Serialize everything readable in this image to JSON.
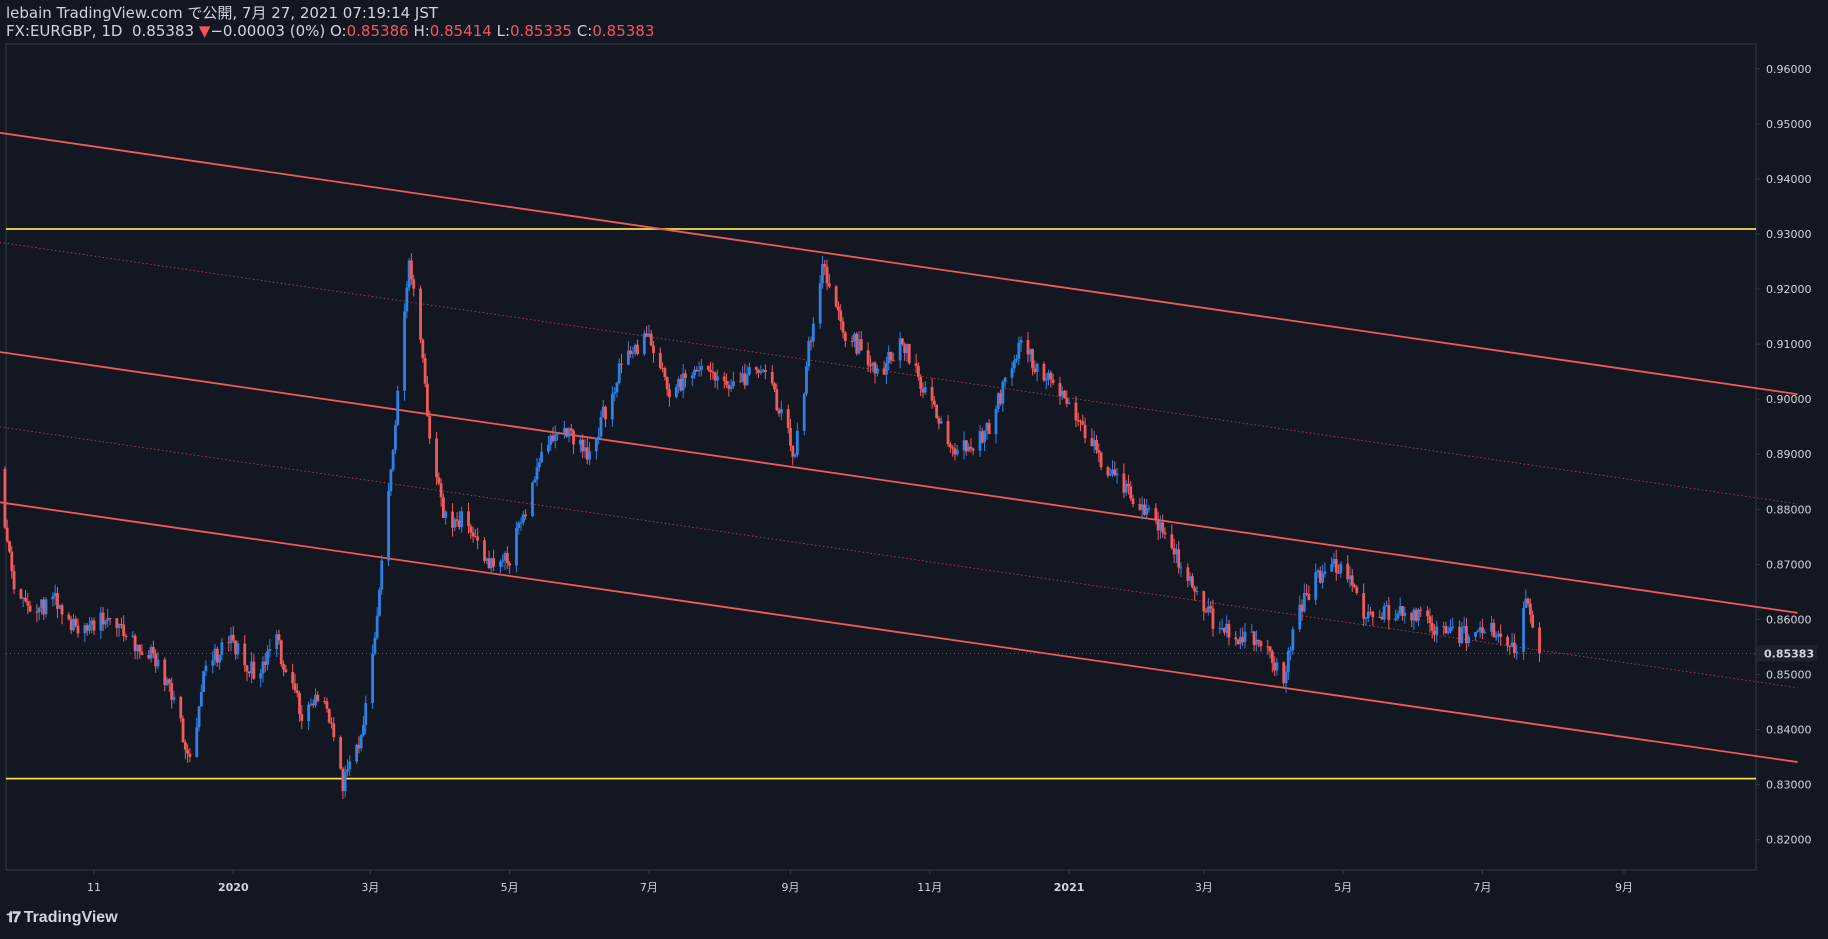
{
  "header": {
    "publisher": "lebain TradingView.com で公開, 7月 27, 2021 07:19:14 JST",
    "symbol": "FX:EURGBP, 1D",
    "last": "0.85383",
    "change_arrow": "▼",
    "change": "−0.00003 (0%)",
    "o_label": "O:",
    "o_value": "0.85386",
    "h_label": "H:",
    "h_value": "0.85414",
    "l_label": "L:",
    "l_value": "0.85335",
    "c_label": "C:",
    "c_value": "0.85383"
  },
  "footer": {
    "logo_text": "TradingView",
    "logo_icon": "tradingview-logo-icon"
  },
  "colors": {
    "background": "#131722",
    "up": "#2e82e5",
    "down": "#f05a5a",
    "channel": "#f05a5a",
    "horizontal": "#f2e24b",
    "grid_text": "#d1d4dc",
    "last_price_bg": "#1e222d"
  },
  "chart_data": {
    "type": "candlestick",
    "title": "",
    "xlabel": "",
    "ylabel": "",
    "ylim": [
      0.8145,
      0.9645
    ],
    "y_ticks": [
      "0.96000",
      "0.95000",
      "0.94000",
      "0.93000",
      "0.92000",
      "0.91000",
      "0.90000",
      "0.89000",
      "0.88000",
      "0.87000",
      "0.86000",
      "0.85000",
      "0.84000",
      "0.83000",
      "0.82000"
    ],
    "x_ticks": [
      {
        "label": "11",
        "date": "2019-11-01"
      },
      {
        "label": "2020",
        "date": "2020-01-01"
      },
      {
        "label": "3月",
        "date": "2020-03-01"
      },
      {
        "label": "5月",
        "date": "2020-05-01"
      },
      {
        "label": "7月",
        "date": "2020-07-01"
      },
      {
        "label": "9月",
        "date": "2020-09-01"
      },
      {
        "label": "11月",
        "date": "2020-11-01"
      },
      {
        "label": "2021",
        "date": "2021-01-01"
      },
      {
        "label": "3月",
        "date": "2021-03-01"
      },
      {
        "label": "5月",
        "date": "2021-05-01"
      },
      {
        "label": "7月",
        "date": "2021-07-01"
      },
      {
        "label": "9月",
        "date": "2021-09-01"
      }
    ],
    "last_price": "0.85383",
    "horizontal_levels": [
      0.9309,
      0.8311
    ],
    "channel_lines": [
      {
        "style": "solid",
        "start": [
          "2019-09-12",
          0.9489
        ],
        "end": [
          "2021-11-16",
          0.9009
        ]
      },
      {
        "style": "solid",
        "start": [
          "2019-09-12",
          0.9091
        ],
        "end": [
          "2021-11-16",
          0.8612
        ]
      },
      {
        "style": "solid",
        "start": [
          "2019-09-12",
          0.8818
        ],
        "end": [
          "2021-11-16",
          0.8341
        ]
      },
      {
        "style": "dotted",
        "start": [
          "2019-09-12",
          0.929
        ],
        "end": [
          "2021-11-16",
          0.881
        ]
      },
      {
        "style": "dotted",
        "start": [
          "2019-09-12",
          0.8955
        ],
        "end": [
          "2021-11-16",
          0.8476
        ]
      }
    ],
    "price_path": [
      [
        "2019-09-12",
        0.889
      ],
      [
        "2019-09-17",
        0.895
      ],
      [
        "2019-09-20",
        0.8875
      ],
      [
        "2019-09-27",
        0.864
      ],
      [
        "2019-10-05",
        0.861
      ],
      [
        "2019-10-15",
        0.864
      ],
      [
        "2019-10-25",
        0.858
      ],
      [
        "2019-11-05",
        0.86
      ],
      [
        "2019-11-15",
        0.857
      ],
      [
        "2019-11-25",
        0.854
      ],
      [
        "2019-12-03",
        0.848
      ],
      [
        "2019-12-08",
        0.842
      ],
      [
        "2019-12-13",
        0.834
      ],
      [
        "2019-12-20",
        0.852
      ],
      [
        "2019-12-31",
        0.856
      ],
      [
        "2020-01-10",
        0.85
      ],
      [
        "2020-01-20",
        0.856
      ],
      [
        "2020-01-31",
        0.843
      ],
      [
        "2020-02-10",
        0.846
      ],
      [
        "2020-02-18",
        0.8305
      ],
      [
        "2020-02-26",
        0.838
      ],
      [
        "2020-03-05",
        0.865
      ],
      [
        "2020-03-12",
        0.895
      ],
      [
        "2020-03-18",
        0.925
      ],
      [
        "2020-03-22",
        0.917
      ],
      [
        "2020-03-27",
        0.893
      ],
      [
        "2020-04-03",
        0.878
      ],
      [
        "2020-04-12",
        0.878
      ],
      [
        "2020-04-20",
        0.871
      ],
      [
        "2020-05-01",
        0.871
      ],
      [
        "2020-05-15",
        0.89
      ],
      [
        "2020-05-25",
        0.895
      ],
      [
        "2020-06-05",
        0.89
      ],
      [
        "2020-06-18",
        0.905
      ],
      [
        "2020-06-30",
        0.912
      ],
      [
        "2020-07-10",
        0.901
      ],
      [
        "2020-07-25",
        0.907
      ],
      [
        "2020-08-05",
        0.902
      ],
      [
        "2020-08-20",
        0.906
      ],
      [
        "2020-09-03",
        0.89
      ],
      [
        "2020-09-10",
        0.912
      ],
      [
        "2020-09-15",
        0.925
      ],
      [
        "2020-09-25",
        0.912
      ],
      [
        "2020-10-10",
        0.905
      ],
      [
        "2020-10-20",
        0.91
      ],
      [
        "2020-11-01",
        0.9
      ],
      [
        "2020-11-12",
        0.89
      ],
      [
        "2020-11-25",
        0.893
      ],
      [
        "2020-12-10",
        0.91
      ],
      [
        "2020-12-20",
        0.905
      ],
      [
        "2021-01-01",
        0.899
      ],
      [
        "2021-01-15",
        0.889
      ],
      [
        "2021-01-28",
        0.883
      ],
      [
        "2021-02-10",
        0.876
      ],
      [
        "2021-02-20",
        0.869
      ],
      [
        "2021-03-05",
        0.86
      ],
      [
        "2021-03-15",
        0.857
      ],
      [
        "2021-03-25",
        0.856
      ],
      [
        "2021-04-05",
        0.85
      ],
      [
        "2021-04-12",
        0.862
      ],
      [
        "2021-04-22",
        0.869
      ],
      [
        "2021-05-01",
        0.87
      ],
      [
        "2021-05-10",
        0.86
      ],
      [
        "2021-05-20",
        0.861
      ],
      [
        "2021-06-01",
        0.861
      ],
      [
        "2021-06-12",
        0.858
      ],
      [
        "2021-06-25",
        0.857
      ],
      [
        "2021-07-05",
        0.859
      ],
      [
        "2021-07-15",
        0.854
      ],
      [
        "2021-07-20",
        0.863
      ],
      [
        "2021-07-26",
        0.8538
      ]
    ]
  }
}
